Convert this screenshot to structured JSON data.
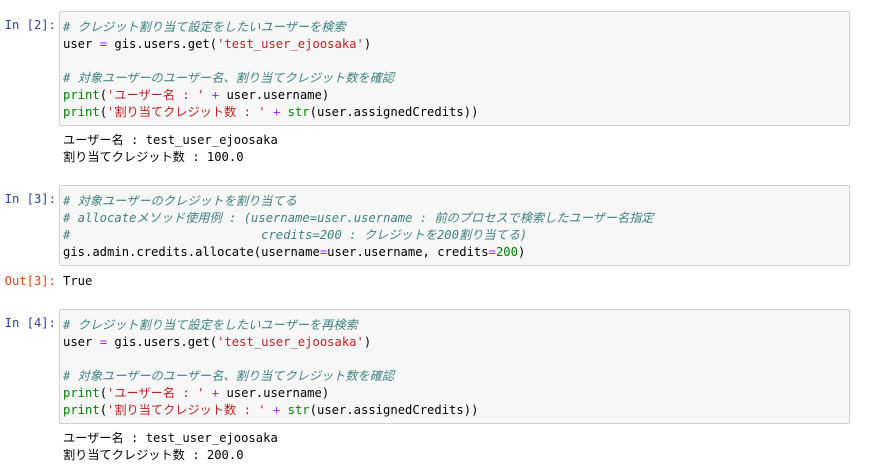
{
  "cells": [
    {
      "prompt": "In [2]:",
      "code": [
        [
          {
            "t": "# クレジット割り当て設定をしたいユーザーを検索",
            "c": "cm"
          }
        ],
        [
          {
            "t": "user ",
            "c": "tx"
          },
          {
            "t": "=",
            "c": "op"
          },
          {
            "t": " gis.users.get(",
            "c": "tx"
          },
          {
            "t": "'test_user_ejoosaka'",
            "c": "st"
          },
          {
            "t": ")",
            "c": "tx"
          }
        ],
        [],
        [
          {
            "t": "# 対象ユーザーのユーザー名、割り当てクレジット数を確認",
            "c": "cm"
          }
        ],
        [
          {
            "t": "print",
            "c": "bi"
          },
          {
            "t": "(",
            "c": "tx"
          },
          {
            "t": "'ユーザー名 : '",
            "c": "st"
          },
          {
            "t": " ",
            "c": "tx"
          },
          {
            "t": "+",
            "c": "op"
          },
          {
            "t": " user.username)",
            "c": "tx"
          }
        ],
        [
          {
            "t": "print",
            "c": "bi"
          },
          {
            "t": "(",
            "c": "tx"
          },
          {
            "t": "'割り当てクレジット数 : '",
            "c": "st"
          },
          {
            "t": " ",
            "c": "tx"
          },
          {
            "t": "+",
            "c": "op"
          },
          {
            "t": " ",
            "c": "tx"
          },
          {
            "t": "str",
            "c": "bi"
          },
          {
            "t": "(user.assignedCredits))",
            "c": "tx"
          }
        ]
      ],
      "output_prompt": "",
      "output": [
        "ユーザー名 : test_user_ejoosaka",
        "割り当てクレジット数 : 100.0"
      ]
    },
    {
      "prompt": "In [3]:",
      "code": [
        [
          {
            "t": "# 対象ユーザーのクレジットを割り当てる",
            "c": "cm"
          }
        ],
        [
          {
            "t": "# allocateメソッド使用例 : (username=user.username : 前のプロセスで検索したユーザー名指定",
            "c": "cm"
          }
        ],
        [
          {
            "t": "#                          credits=200 : クレジットを200割り当てる)",
            "c": "cm"
          }
        ],
        [
          {
            "t": "gis.admin.credits.allocate(username",
            "c": "tx"
          },
          {
            "t": "=",
            "c": "op"
          },
          {
            "t": "user.username, credits",
            "c": "tx"
          },
          {
            "t": "=",
            "c": "op"
          },
          {
            "t": "200",
            "c": "nm"
          },
          {
            "t": ")",
            "c": "tx"
          }
        ]
      ],
      "output_prompt": "Out[3]:",
      "output": [
        "True"
      ]
    },
    {
      "prompt": "In [4]:",
      "code": [
        [
          {
            "t": "# クレジット割り当て設定をしたいユーザーを再検索",
            "c": "cm"
          }
        ],
        [
          {
            "t": "user ",
            "c": "tx"
          },
          {
            "t": "=",
            "c": "op"
          },
          {
            "t": " gis.users.get(",
            "c": "tx"
          },
          {
            "t": "'test_user_ejoosaka'",
            "c": "st"
          },
          {
            "t": ")",
            "c": "tx"
          }
        ],
        [],
        [
          {
            "t": "# 対象ユーザーのユーザー名、割り当てクレジット数を確認",
            "c": "cm"
          }
        ],
        [
          {
            "t": "print",
            "c": "bi"
          },
          {
            "t": "(",
            "c": "tx"
          },
          {
            "t": "'ユーザー名 : '",
            "c": "st"
          },
          {
            "t": " ",
            "c": "tx"
          },
          {
            "t": "+",
            "c": "op"
          },
          {
            "t": " user.username)",
            "c": "tx"
          }
        ],
        [
          {
            "t": "print",
            "c": "bi"
          },
          {
            "t": "(",
            "c": "tx"
          },
          {
            "t": "'割り当てクレジット数 : '",
            "c": "st"
          },
          {
            "t": " ",
            "c": "tx"
          },
          {
            "t": "+",
            "c": "op"
          },
          {
            "t": " ",
            "c": "tx"
          },
          {
            "t": "str",
            "c": "bi"
          },
          {
            "t": "(user.assignedCredits))",
            "c": "tx"
          }
        ]
      ],
      "output_prompt": "",
      "output": [
        "ユーザー名 : test_user_ejoosaka",
        "割り当てクレジット数 : 200.0"
      ]
    }
  ]
}
